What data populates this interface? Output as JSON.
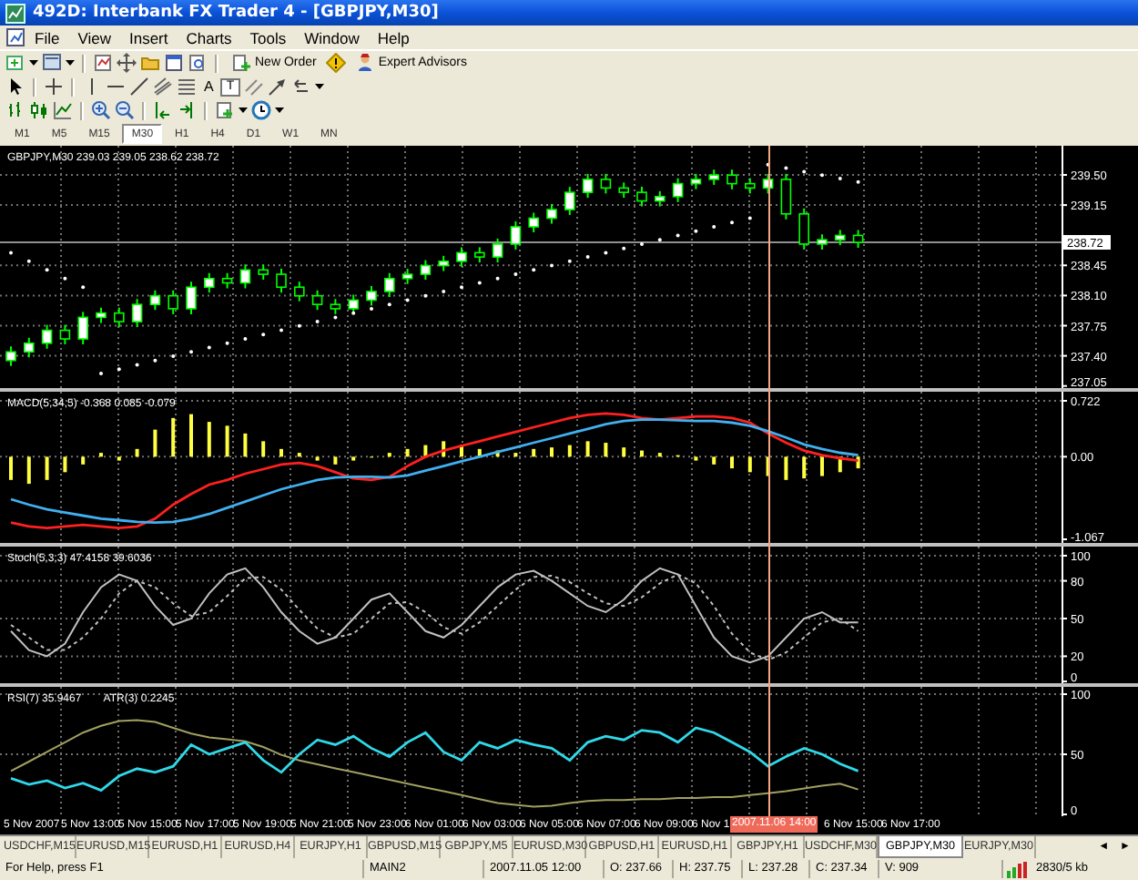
{
  "window": {
    "title": "492D: Interbank FX Trader 4 - [GBPJPY,M30]"
  },
  "menu": [
    "File",
    "View",
    "Insert",
    "Charts",
    "Tools",
    "Window",
    "Help"
  ],
  "toolbar": {
    "new_order": "New Order",
    "expert_advisors": "Expert Advisors"
  },
  "drawing_tools": {
    "text_tool": "A",
    "label_tool": "T"
  },
  "timeframes": [
    {
      "label": "M1",
      "selected": false
    },
    {
      "label": "M5",
      "selected": false
    },
    {
      "label": "M15",
      "selected": false
    },
    {
      "label": "M30",
      "selected": true
    },
    {
      "label": "H1",
      "selected": false
    },
    {
      "label": "H4",
      "selected": false
    },
    {
      "label": "D1",
      "selected": false
    },
    {
      "label": "W1",
      "selected": false
    },
    {
      "label": "MN",
      "selected": false
    }
  ],
  "chart": {
    "main": {
      "labels": [
        "GBPJPY,M30 239.03 239.05 238.62 238.72"
      ],
      "axis": [
        "239.50",
        "239.15",
        "238.45",
        "238.10",
        "237.75",
        "237.40",
        "237.05"
      ],
      "price_tag": "238.72"
    },
    "macd": {
      "labels": [
        "MACD(5,34,5) -0.368 0.085 -0.079"
      ],
      "axis": [
        "0.722",
        "0.00",
        "-1.067"
      ]
    },
    "stochastic": {
      "labels": [
        "Stoch(5,3,3) 47.4158 39.6036"
      ],
      "axis": [
        "100",
        "80",
        "50",
        "20",
        "0"
      ]
    },
    "rsi": {
      "labels": [
        "RSI(7) 35.9467",
        "ATR(3) 0.2245"
      ],
      "axis": [
        "100",
        "50",
        "0"
      ]
    },
    "time_axis": [
      "5 Nov 2007",
      "5 Nov 13:00",
      "5 Nov 15:00",
      "5 Nov 17:00",
      "5 Nov 19:00",
      "5 Nov 21:00",
      "5 Nov 23:00",
      "6 Nov 01:00",
      "6 Nov 03:00",
      "6 Nov 05:00",
      "6 Nov 07:00",
      "6 Nov 09:00",
      "6 Nov 1",
      "6 Nov 15:00",
      "6 Nov 17:00"
    ],
    "crosshair_time": "2007.11.06 14:00"
  },
  "tabs": [
    {
      "label": "USDCHF,M15",
      "selected": false
    },
    {
      "label": "EURUSD,M15",
      "selected": false
    },
    {
      "label": "EURUSD,H1",
      "selected": false
    },
    {
      "label": "EURUSD,H4",
      "selected": false
    },
    {
      "label": "EURJPY,H1",
      "selected": false
    },
    {
      "label": "GBPUSD,M15",
      "selected": false
    },
    {
      "label": "GBPJPY,M5",
      "selected": false
    },
    {
      "label": "EURUSD,M30",
      "selected": false
    },
    {
      "label": "GBPUSD,H1",
      "selected": false
    },
    {
      "label": "EURUSD,H1",
      "selected": false
    },
    {
      "label": "GBPJPY,H1",
      "selected": false
    },
    {
      "label": "USDCHF,M30",
      "selected": false
    },
    {
      "label": "GBPJPY,M30",
      "selected": true
    },
    {
      "label": "EURJPY,M30",
      "selected": false
    }
  ],
  "tab_scroll": [
    "◄",
    "►"
  ],
  "status_bar": [
    "For Help, press F1",
    "MAIN2",
    "2007.11.05 12:00",
    "O: 237.66",
    "H: 237.75",
    "L: 237.28",
    "C: 237.34",
    "V: 909",
    "2830/5 kb"
  ]
}
